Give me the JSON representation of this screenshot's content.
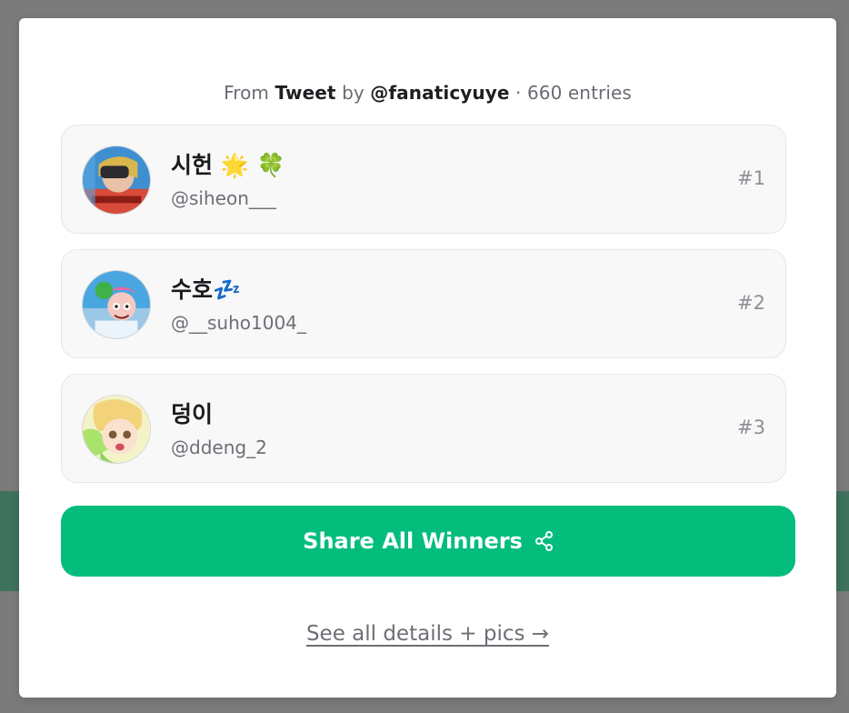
{
  "header": {
    "prefix": "From",
    "source": "Tweet",
    "by": "by",
    "author": "@fanaticyuye",
    "separator": "·",
    "entries": "660 entries"
  },
  "winners": [
    {
      "name": "시헌 🌟 🍀",
      "handle": "@siheon___",
      "rank": "#1",
      "avatar_icon": "profile-photo-vr-headset"
    },
    {
      "name": "수호💤",
      "handle": "@__suho1004_",
      "rank": "#2",
      "avatar_icon": "profile-cartoon-fairy"
    },
    {
      "name": "덩이",
      "handle": "@ddeng_2",
      "rank": "#3",
      "avatar_icon": "profile-anime-character"
    }
  ],
  "share_button": {
    "label": "Share All Winners",
    "icon": "share-icon"
  },
  "details_link": {
    "label": "See all details + pics →"
  },
  "colors": {
    "accent": "#04bd7c",
    "card_bg": "#f8f8f9",
    "text": "#1b1b1f",
    "muted": "#6e6e76"
  }
}
